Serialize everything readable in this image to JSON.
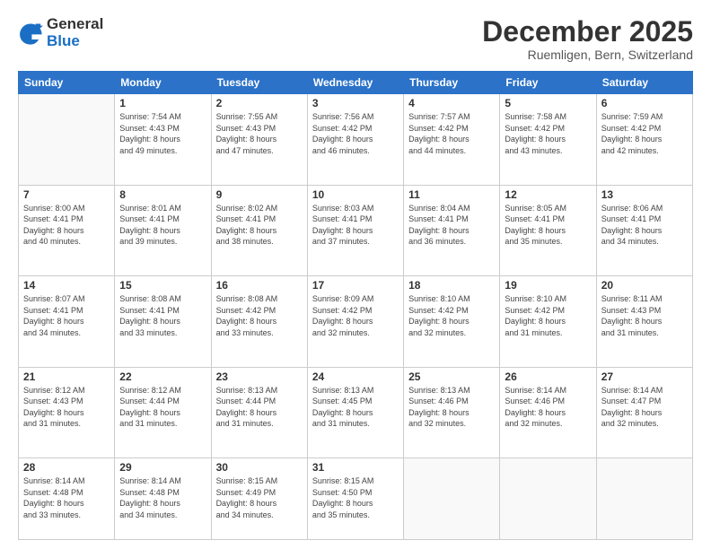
{
  "logo": {
    "general": "General",
    "blue": "Blue"
  },
  "title": "December 2025",
  "subtitle": "Ruemligen, Bern, Switzerland",
  "weekdays": [
    "Sunday",
    "Monday",
    "Tuesday",
    "Wednesday",
    "Thursday",
    "Friday",
    "Saturday"
  ],
  "weeks": [
    [
      {
        "day": "",
        "info": ""
      },
      {
        "day": "1",
        "info": "Sunrise: 7:54 AM\nSunset: 4:43 PM\nDaylight: 8 hours\nand 49 minutes."
      },
      {
        "day": "2",
        "info": "Sunrise: 7:55 AM\nSunset: 4:43 PM\nDaylight: 8 hours\nand 47 minutes."
      },
      {
        "day": "3",
        "info": "Sunrise: 7:56 AM\nSunset: 4:42 PM\nDaylight: 8 hours\nand 46 minutes."
      },
      {
        "day": "4",
        "info": "Sunrise: 7:57 AM\nSunset: 4:42 PM\nDaylight: 8 hours\nand 44 minutes."
      },
      {
        "day": "5",
        "info": "Sunrise: 7:58 AM\nSunset: 4:42 PM\nDaylight: 8 hours\nand 43 minutes."
      },
      {
        "day": "6",
        "info": "Sunrise: 7:59 AM\nSunset: 4:42 PM\nDaylight: 8 hours\nand 42 minutes."
      }
    ],
    [
      {
        "day": "7",
        "info": "Sunrise: 8:00 AM\nSunset: 4:41 PM\nDaylight: 8 hours\nand 40 minutes."
      },
      {
        "day": "8",
        "info": "Sunrise: 8:01 AM\nSunset: 4:41 PM\nDaylight: 8 hours\nand 39 minutes."
      },
      {
        "day": "9",
        "info": "Sunrise: 8:02 AM\nSunset: 4:41 PM\nDaylight: 8 hours\nand 38 minutes."
      },
      {
        "day": "10",
        "info": "Sunrise: 8:03 AM\nSunset: 4:41 PM\nDaylight: 8 hours\nand 37 minutes."
      },
      {
        "day": "11",
        "info": "Sunrise: 8:04 AM\nSunset: 4:41 PM\nDaylight: 8 hours\nand 36 minutes."
      },
      {
        "day": "12",
        "info": "Sunrise: 8:05 AM\nSunset: 4:41 PM\nDaylight: 8 hours\nand 35 minutes."
      },
      {
        "day": "13",
        "info": "Sunrise: 8:06 AM\nSunset: 4:41 PM\nDaylight: 8 hours\nand 34 minutes."
      }
    ],
    [
      {
        "day": "14",
        "info": "Sunrise: 8:07 AM\nSunset: 4:41 PM\nDaylight: 8 hours\nand 34 minutes."
      },
      {
        "day": "15",
        "info": "Sunrise: 8:08 AM\nSunset: 4:41 PM\nDaylight: 8 hours\nand 33 minutes."
      },
      {
        "day": "16",
        "info": "Sunrise: 8:08 AM\nSunset: 4:42 PM\nDaylight: 8 hours\nand 33 minutes."
      },
      {
        "day": "17",
        "info": "Sunrise: 8:09 AM\nSunset: 4:42 PM\nDaylight: 8 hours\nand 32 minutes."
      },
      {
        "day": "18",
        "info": "Sunrise: 8:10 AM\nSunset: 4:42 PM\nDaylight: 8 hours\nand 32 minutes."
      },
      {
        "day": "19",
        "info": "Sunrise: 8:10 AM\nSunset: 4:42 PM\nDaylight: 8 hours\nand 31 minutes."
      },
      {
        "day": "20",
        "info": "Sunrise: 8:11 AM\nSunset: 4:43 PM\nDaylight: 8 hours\nand 31 minutes."
      }
    ],
    [
      {
        "day": "21",
        "info": "Sunrise: 8:12 AM\nSunset: 4:43 PM\nDaylight: 8 hours\nand 31 minutes."
      },
      {
        "day": "22",
        "info": "Sunrise: 8:12 AM\nSunset: 4:44 PM\nDaylight: 8 hours\nand 31 minutes."
      },
      {
        "day": "23",
        "info": "Sunrise: 8:13 AM\nSunset: 4:44 PM\nDaylight: 8 hours\nand 31 minutes."
      },
      {
        "day": "24",
        "info": "Sunrise: 8:13 AM\nSunset: 4:45 PM\nDaylight: 8 hours\nand 31 minutes."
      },
      {
        "day": "25",
        "info": "Sunrise: 8:13 AM\nSunset: 4:46 PM\nDaylight: 8 hours\nand 32 minutes."
      },
      {
        "day": "26",
        "info": "Sunrise: 8:14 AM\nSunset: 4:46 PM\nDaylight: 8 hours\nand 32 minutes."
      },
      {
        "day": "27",
        "info": "Sunrise: 8:14 AM\nSunset: 4:47 PM\nDaylight: 8 hours\nand 32 minutes."
      }
    ],
    [
      {
        "day": "28",
        "info": "Sunrise: 8:14 AM\nSunset: 4:48 PM\nDaylight: 8 hours\nand 33 minutes."
      },
      {
        "day": "29",
        "info": "Sunrise: 8:14 AM\nSunset: 4:48 PM\nDaylight: 8 hours\nand 34 minutes."
      },
      {
        "day": "30",
        "info": "Sunrise: 8:15 AM\nSunset: 4:49 PM\nDaylight: 8 hours\nand 34 minutes."
      },
      {
        "day": "31",
        "info": "Sunrise: 8:15 AM\nSunset: 4:50 PM\nDaylight: 8 hours\nand 35 minutes."
      },
      {
        "day": "",
        "info": ""
      },
      {
        "day": "",
        "info": ""
      },
      {
        "day": "",
        "info": ""
      }
    ]
  ],
  "colors": {
    "header_bg": "#2b72c8",
    "header_text": "#ffffff",
    "accent": "#1a6fc4"
  }
}
